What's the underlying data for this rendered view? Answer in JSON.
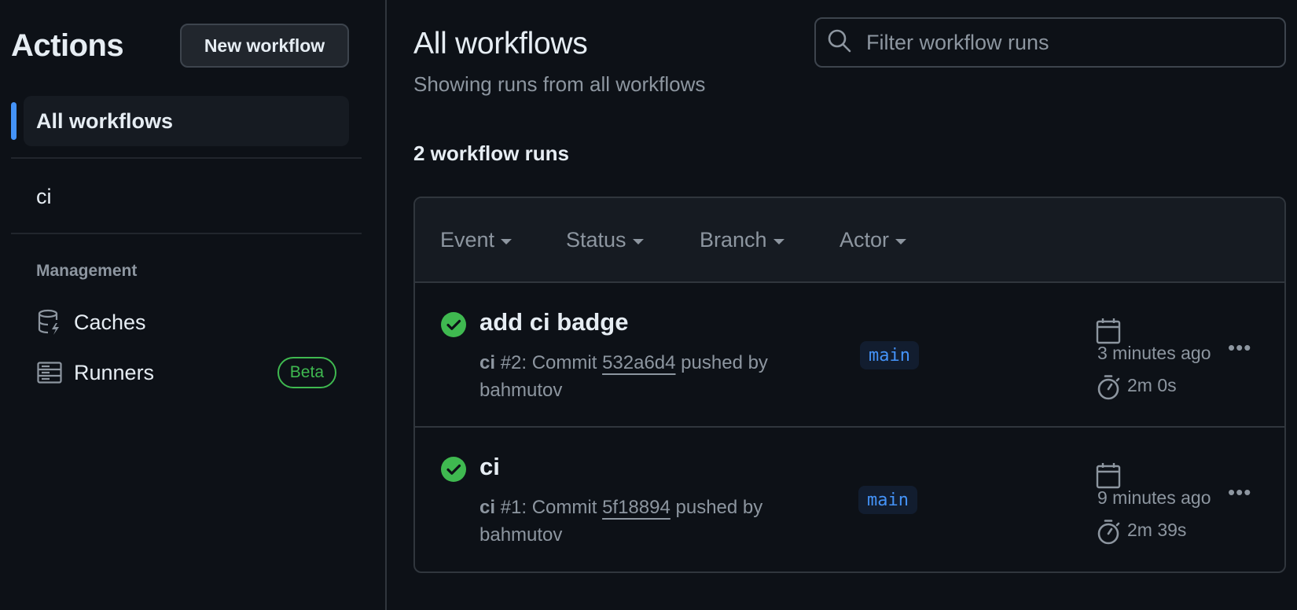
{
  "sidebar": {
    "title": "Actions",
    "new_workflow_label": "New workflow",
    "nav": {
      "all_workflows": "All workflows",
      "ci": "ci"
    },
    "management": {
      "label": "Management",
      "items": [
        {
          "label": "Caches",
          "icon": "database-cache-icon"
        },
        {
          "label": "Runners",
          "icon": "server-icon",
          "badge": "Beta"
        }
      ]
    }
  },
  "main": {
    "title": "All workflows",
    "subtitle": "Showing runs from all workflows",
    "search": {
      "placeholder": "Filter workflow runs"
    },
    "runs_count": "2 workflow runs",
    "filters": [
      "Event",
      "Status",
      "Branch",
      "Actor"
    ],
    "runs": [
      {
        "title": "add ci badge",
        "workflow": "ci",
        "run_number": "#2",
        "meta_prefix": ": Commit",
        "sha": "532a6d4",
        "meta_suffix": "pushed by",
        "actor": "bahmutov",
        "branch": "main",
        "time": "3 minutes ago",
        "duration": "2m 0s",
        "status": "success"
      },
      {
        "title": "ci",
        "workflow": "ci",
        "run_number": "#1",
        "meta_prefix": ": Commit",
        "sha": "5f18894",
        "meta_suffix": "pushed by",
        "actor": "bahmutov",
        "branch": "main",
        "time": "9 minutes ago",
        "duration": "2m 39s",
        "status": "success"
      }
    ],
    "kebab": "•••"
  },
  "colors": {
    "background": "#0d1117",
    "accent": "#4493f8",
    "success": "#3fb950",
    "muted": "#8d96a0"
  }
}
